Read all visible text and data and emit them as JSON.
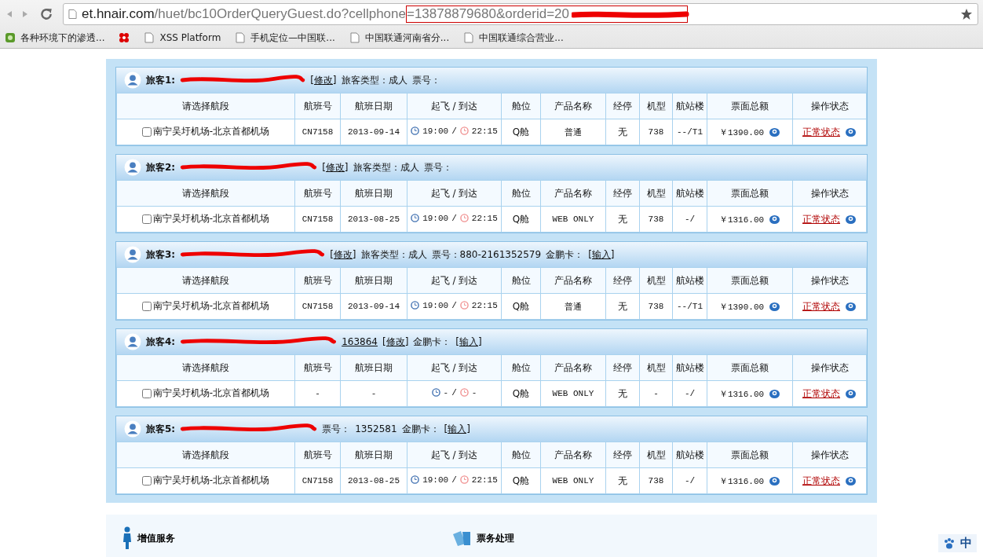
{
  "browser": {
    "url_host": "et.hnair.com",
    "url_path": "/huet/bc10OrderQueryGuest.do?cellphone",
    "url_marked": "=13878879680&orderid=20",
    "bookmarks": [
      {
        "label": "各种环境下的渗透...",
        "kind": "app"
      },
      {
        "kind": "unicom"
      },
      {
        "label": "XSS Platform",
        "kind": "page"
      },
      {
        "label": "手机定位—中国联...",
        "kind": "page"
      },
      {
        "label": "中国联通河南省分...",
        "kind": "page"
      },
      {
        "label": "中国联通综合营业...",
        "kind": "page"
      }
    ]
  },
  "passengers": [
    {
      "label": "旅客1:",
      "header": [
        {
          "text": "[修改]",
          "kind": "link"
        },
        {
          "text": "旅客类型：成人",
          "kind": "text"
        },
        {
          "text": "票号：",
          "kind": "text"
        }
      ],
      "columns": [
        "请选择航段",
        "航班号",
        "航班日期",
        "起飞 / 到达",
        "舱位",
        "产品名称",
        "经停",
        "机型",
        "航站楼",
        "票面总额",
        "操作状态"
      ],
      "row": {
        "segment": "南宁吴圩机场-北京首都机场",
        "checked": false,
        "flight": "CN7158",
        "date": "2013-09-14",
        "dep": "19:00",
        "sep": "/",
        "arr": "22:15",
        "cabin": "Q舱",
        "product": "普通",
        "stop": "无",
        "aircraft": "738",
        "terminal": "--/T1",
        "price": "￥1390.00",
        "status": "正常状态"
      }
    },
    {
      "label": "旅客2:",
      "header": [
        {
          "text": "[修改]",
          "kind": "link"
        },
        {
          "text": "旅客类型：成人",
          "kind": "text"
        },
        {
          "text": "票号：",
          "kind": "text"
        }
      ],
      "columns": [
        "请选择航段",
        "航班号",
        "航班日期",
        "起飞 / 到达",
        "舱位",
        "产品名称",
        "经停",
        "机型",
        "航站楼",
        "票面总额",
        "操作状态"
      ],
      "row": {
        "segment": "南宁吴圩机场-北京首都机场",
        "checked": false,
        "flight": "CN7158",
        "date": "2013-08-25",
        "dep": "19:00",
        "sep": "/",
        "arr": "22:15",
        "cabin": "Q舱",
        "product": "WEB ONLY",
        "stop": "无",
        "aircraft": "738",
        "terminal": "-/",
        "price": "￥1316.00",
        "status": "正常状态"
      }
    },
    {
      "label": "旅客3:",
      "header": [
        {
          "text": "[修改]",
          "kind": "link"
        },
        {
          "text": "旅客类型：成人",
          "kind": "text"
        },
        {
          "text": "票号：880-2161352579",
          "kind": "text"
        },
        {
          "text": "金鹏卡：",
          "kind": "text"
        },
        {
          "text": "[输入]",
          "kind": "link"
        }
      ],
      "columns": [
        "请选择航段",
        "航班号",
        "航班日期",
        "起飞 / 到达",
        "舱位",
        "产品名称",
        "经停",
        "机型",
        "航站楼",
        "票面总额",
        "操作状态"
      ],
      "row": {
        "segment": "南宁吴圩机场-北京首都机场",
        "checked": false,
        "flight": "CN7158",
        "date": "2013-09-14",
        "dep": "19:00",
        "sep": "/",
        "arr": "22:15",
        "cabin": "Q舱",
        "product": "普通",
        "stop": "无",
        "aircraft": "738",
        "terminal": "--/T1",
        "price": "￥1390.00",
        "status": "正常状态"
      }
    },
    {
      "label": "旅客4:",
      "header": [
        {
          "text": "163864",
          "kind": "link"
        },
        {
          "text": "[修改]",
          "kind": "link"
        },
        {
          "text": "金鹏卡：",
          "kind": "text"
        },
        {
          "text": "[输入]",
          "kind": "link"
        }
      ],
      "columns": [
        "请选择航段",
        "航班号",
        "航班日期",
        "起飞 / 到达",
        "舱位",
        "产品名称",
        "经停",
        "机型",
        "航站楼",
        "票面总额",
        "操作状态"
      ],
      "row": {
        "segment": "南宁吴圩机场-北京首都机场",
        "checked": false,
        "flight": "-",
        "date": "-",
        "dep": "-",
        "sep": "/",
        "arr": "-",
        "cabin": "Q舱",
        "product": "WEB ONLY",
        "stop": "无",
        "aircraft": "-",
        "terminal": "-/",
        "price": "￥1316.00",
        "status": "正常状态"
      }
    },
    {
      "label": "旅客5:",
      "header": [
        {
          "text": "票号：",
          "kind": "text"
        },
        {
          "text": "1352581",
          "kind": "text"
        },
        {
          "text": "金鹏卡：",
          "kind": "text"
        },
        {
          "text": "[输入]",
          "kind": "link"
        }
      ],
      "columns": [
        "请选择航段",
        "航班号",
        "航班日期",
        "起飞 / 到达",
        "舱位",
        "产品名称",
        "经停",
        "机型",
        "航站楼",
        "票面总额",
        "操作状态"
      ],
      "row": {
        "segment": "南宁吴圩机场-北京首都机场",
        "checked": false,
        "flight": "CN7158",
        "date": "2013-08-25",
        "dep": "19:00",
        "sep": "/",
        "arr": "22:15",
        "cabin": "Q舱",
        "product": "WEB ONLY",
        "stop": "无",
        "aircraft": "738",
        "terminal": "-/",
        "price": "￥1316.00",
        "status": "正常状态"
      }
    }
  ],
  "services": [
    {
      "label": "增值服务",
      "kind": "attendant"
    },
    {
      "label": "票务处理",
      "kind": "tickets"
    }
  ],
  "ime": {
    "label": "中"
  }
}
